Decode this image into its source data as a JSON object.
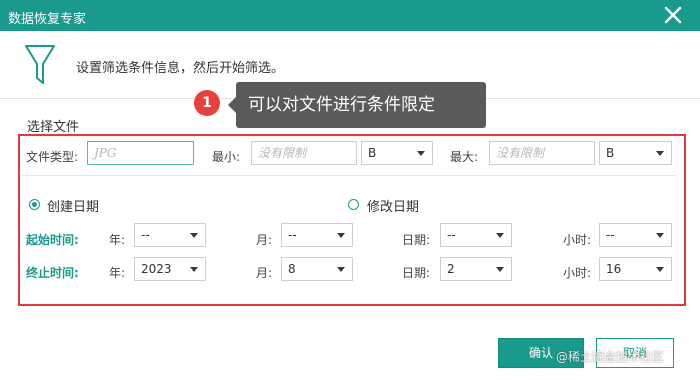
{
  "window": {
    "title": "数据恢复专家"
  },
  "header": {
    "instruction": "设置筛选条件信息，然后开始筛选。"
  },
  "annotation": {
    "badge": "1",
    "tooltip": "可以对文件进行条件限定"
  },
  "section": {
    "title": "选择文件"
  },
  "file_filter": {
    "type_label": "文件类型:",
    "type_placeholder": "JPG",
    "min_label": "最小:",
    "min_placeholder": "没有限制",
    "min_unit": "B",
    "max_label": "最大:",
    "max_placeholder": "没有限制",
    "max_unit": "B"
  },
  "date_mode": {
    "options": [
      {
        "label": "创建日期",
        "checked": true
      },
      {
        "label": "修改日期",
        "checked": false
      }
    ]
  },
  "start_time": {
    "label": "起始时间:",
    "year_label": "年:",
    "year_value": "--",
    "month_label": "月:",
    "month_value": "--",
    "day_label": "日期:",
    "day_value": "--",
    "hour_label": "小时:",
    "hour_value": "--"
  },
  "end_time": {
    "label": "终止时间:",
    "year_label": "年:",
    "year_value": "2023",
    "month_label": "月:",
    "month_value": "8",
    "day_label": "日期:",
    "day_value": "2",
    "hour_label": "小时:",
    "hour_value": "16"
  },
  "buttons": {
    "confirm": "确认",
    "cancel": "取消"
  },
  "watermark": "@稀土掘金技术社区",
  "colors": {
    "accent": "#1a9a8c",
    "highlight_border": "#e03a3a",
    "tooltip_bg": "#5a5a5a",
    "badge": "#e8403a"
  },
  "icons": {
    "close": "close-icon",
    "funnel": "funnel-icon",
    "dropdown": "chevron-down-icon"
  }
}
